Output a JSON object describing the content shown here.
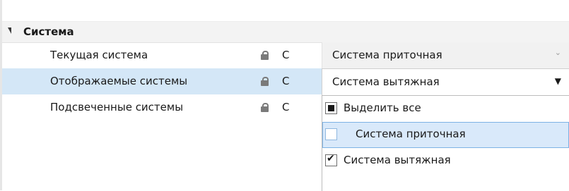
{
  "category": {
    "label": "Система"
  },
  "rows": [
    {
      "name": "Текущая система",
      "cap": "C",
      "value": "Система приточная"
    },
    {
      "name": "Отображаемые системы",
      "cap": "C",
      "value": "Система вытяжная"
    },
    {
      "name": "Подсвеченные системы",
      "cap": "C"
    }
  ],
  "dropdown": {
    "options": [
      {
        "label": "Выделить все",
        "state": "indeterminate"
      },
      {
        "label": "Система приточная",
        "state": "unchecked"
      },
      {
        "label": "Система вытяжная",
        "state": "checked"
      }
    ]
  },
  "icons": {
    "collapse": "triangle-down-icon",
    "lock": "lock-icon",
    "chevron": "chevron-down-icon"
  },
  "colors": {
    "selected_row": "#d4e7f7",
    "hover_option": "#d9e9fa",
    "category_bg": "#f3f3f3"
  }
}
